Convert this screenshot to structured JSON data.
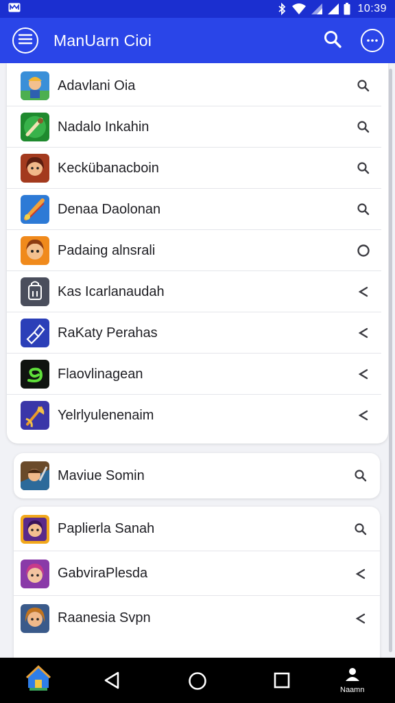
{
  "status_bar": {
    "time": "10:39",
    "icons": [
      "notification-icon",
      "bluetooth-icon",
      "wifi-icon",
      "signal-icon",
      "battery-icon"
    ]
  },
  "app_bar": {
    "title": "ManUarn Cioi",
    "background": "#2a45e8",
    "icons": [
      "menu-icon",
      "search-icon",
      "more-icon"
    ]
  },
  "list_main": [
    {
      "label": "Adavlani Oia",
      "icon": "game-hero-icon",
      "action": "search-icon"
    },
    {
      "label": "Nadalo Inkahin",
      "icon": "game-sword-icon",
      "action": "search-icon"
    },
    {
      "label": "Keckübanacboin",
      "icon": "game-warrior-icon",
      "action": "search-icon"
    },
    {
      "label": "Denaa Daolonan",
      "icon": "game-blade-icon",
      "action": "search-icon"
    },
    {
      "label": "Padaing alnsrali",
      "icon": "game-character-icon",
      "action": "circle-icon"
    },
    {
      "label": "Kas Icarlanaudah",
      "icon": "game-lock-icon",
      "action": "chevron-left-icon"
    },
    {
      "label": "RaKaty Perahas",
      "icon": "game-cube-icon",
      "action": "chevron-left-icon"
    },
    {
      "label": "Flaovlinagean",
      "icon": "game-snake-icon",
      "action": "chevron-left-icon"
    },
    {
      "label": "Yelrlyulenenaim",
      "icon": "game-axe-icon",
      "action": "chevron-left-icon"
    }
  ],
  "list_single": [
    {
      "label": "Maviue Somin",
      "icon": "game-knight-icon",
      "action": "search-icon"
    }
  ],
  "list_bottom": [
    {
      "label": "Paplierla Sanah",
      "icon": "game-princess-icon",
      "action": "search-icon"
    },
    {
      "label": "GabviraPlesda",
      "icon": "game-girl-icon",
      "action": "chevron-left-icon"
    },
    {
      "label": "Raanesia Svpn",
      "icon": "game-heroine-icon",
      "action": "chevron-left-icon"
    }
  ],
  "nav_bar": {
    "profile_label": "Naamn",
    "icons": [
      "home-icon",
      "back-icon",
      "home-circle-icon",
      "recents-icon",
      "profile-icon"
    ]
  },
  "colors": {
    "status_bar": "#1b2fd0",
    "app_bar": "#2a45e8",
    "background": "#f1f2f6",
    "nav_bar": "#000000"
  }
}
